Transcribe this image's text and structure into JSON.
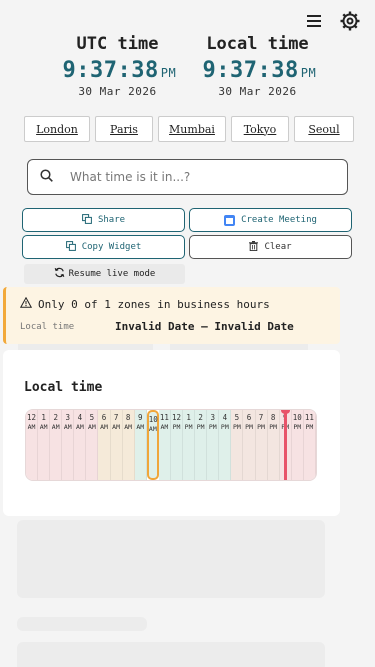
{
  "header": {
    "menu_icon": "hamburger-icon",
    "settings_icon": "gear-icon"
  },
  "clocks": {
    "utc": {
      "label": "UTC time",
      "time": "9:37:38",
      "ampm": "PM",
      "date": "30 Mar 2026"
    },
    "local": {
      "label": "Local time",
      "time": "9:37:38",
      "ampm": "PM",
      "date": "30 Mar 2026"
    }
  },
  "cities": [
    "London",
    "Paris",
    "Mumbai",
    "Tokyo",
    "Seoul"
  ],
  "search": {
    "placeholder": "What time is it in...?",
    "value": ""
  },
  "actions": {
    "share": "Share",
    "create_meeting": "Create Meeting",
    "copy_widget": "Copy Widget",
    "clear": "Clear",
    "resume": "Resume live mode"
  },
  "banner": {
    "message": "Only 0 of 1 zones in business hours",
    "row_label": "Local time",
    "row_value": "Invalid Date — Invalid Date"
  },
  "panel": {
    "title": "Local time"
  },
  "timeline": {
    "hours": [
      {
        "n": "12",
        "ap": "AM"
      },
      {
        "n": "1",
        "ap": "AM"
      },
      {
        "n": "2",
        "ap": "AM"
      },
      {
        "n": "3",
        "ap": "AM"
      },
      {
        "n": "4",
        "ap": "AM"
      },
      {
        "n": "5",
        "ap": "AM"
      },
      {
        "n": "6",
        "ap": "AM"
      },
      {
        "n": "7",
        "ap": "AM"
      },
      {
        "n": "8",
        "ap": "AM"
      },
      {
        "n": "9",
        "ap": "AM"
      },
      {
        "n": "10",
        "ap": "AM"
      },
      {
        "n": "11",
        "ap": "AM"
      },
      {
        "n": "12",
        "ap": "PM"
      },
      {
        "n": "1",
        "ap": "PM"
      },
      {
        "n": "2",
        "ap": "PM"
      },
      {
        "n": "3",
        "ap": "PM"
      },
      {
        "n": "4",
        "ap": "PM"
      },
      {
        "n": "5",
        "ap": "PM"
      },
      {
        "n": "6",
        "ap": "PM"
      },
      {
        "n": "7",
        "ap": "PM"
      },
      {
        "n": "8",
        "ap": "PM"
      },
      {
        "n": "9",
        "ap": "PM"
      },
      {
        "n": "10",
        "ap": "PM"
      },
      {
        "n": "11",
        "ap": "PM"
      }
    ],
    "colors": {
      "night": "#f7e2e3",
      "morning": "#f5ead9",
      "day": "#dff0ea",
      "evening": "#f3e6e0"
    },
    "now_marker_color": "#e8536a",
    "selection_color": "#f0a63a"
  }
}
